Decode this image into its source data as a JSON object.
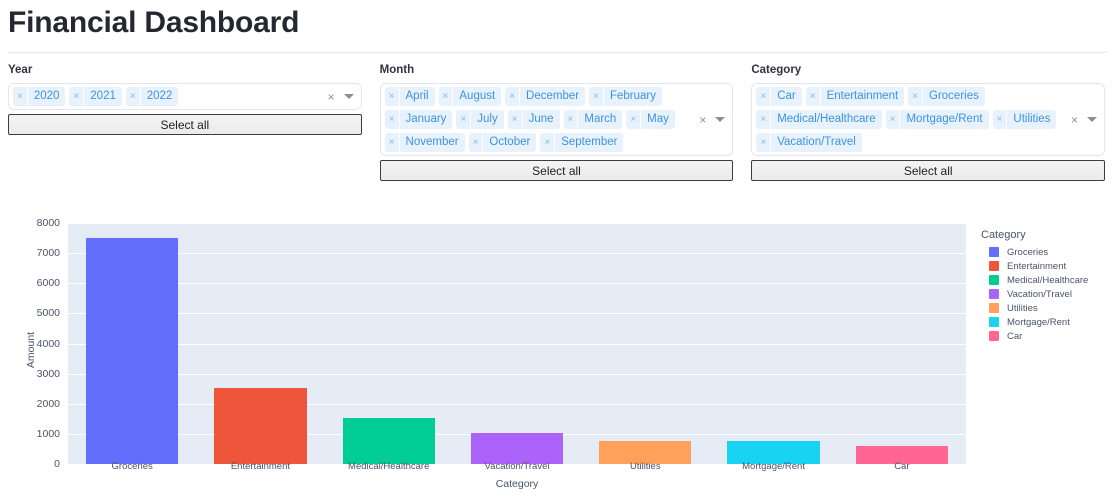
{
  "header": {
    "title": "Financial Dashboard"
  },
  "filters": [
    {
      "label": "Year",
      "tags": [
        "2020",
        "2021",
        "2022"
      ],
      "remove_icon": "×",
      "clear_icon": "×",
      "caret_icon": "chevron-down-icon",
      "select_all_label": "Select all"
    },
    {
      "label": "Month",
      "tags": [
        "April",
        "August",
        "December",
        "February",
        "January",
        "July",
        "June",
        "March",
        "May",
        "November",
        "October",
        "September"
      ],
      "remove_icon": "×",
      "clear_icon": "×",
      "caret_icon": "chevron-down-icon",
      "select_all_label": "Select all"
    },
    {
      "label": "Category",
      "tags": [
        "Car",
        "Entertainment",
        "Groceries",
        "Medical/Healthcare",
        "Mortgage/Rent",
        "Utilities",
        "Vacation/Travel"
      ],
      "remove_icon": "×",
      "clear_icon": "×",
      "caret_icon": "chevron-down-icon",
      "select_all_label": "Select all"
    }
  ],
  "chart_data": {
    "type": "bar",
    "title": "",
    "xlabel": "Category",
    "ylabel": "Amount",
    "categories": [
      "Groceries",
      "Entertainment",
      "Medical/Healthcare",
      "Vacation/Travel",
      "Utilities",
      "Mortgage/Rent",
      "Car"
    ],
    "values": [
      7500,
      2510,
      1520,
      1020,
      780,
      750,
      610
    ],
    "colors": [
      "#636efa",
      "#ef553b",
      "#00cc96",
      "#ab63fa",
      "#ffa15a",
      "#19d3f3",
      "#ff6692"
    ],
    "ylim": [
      0,
      8000
    ],
    "yticks": [
      0,
      1000,
      2000,
      3000,
      4000,
      5000,
      6000,
      7000,
      8000
    ],
    "ytick_labels": [
      "0",
      "1000",
      "2000",
      "3000",
      "4000",
      "5000",
      "6000",
      "7000",
      "8000"
    ],
    "grid": true,
    "legend": {
      "title": "Category",
      "position": "right",
      "entries": [
        {
          "label": "Groceries",
          "color": "#636efa"
        },
        {
          "label": "Entertainment",
          "color": "#ef553b"
        },
        {
          "label": "Medical/Healthcare",
          "color": "#00cc96"
        },
        {
          "label": "Vacation/Travel",
          "color": "#ab63fa"
        },
        {
          "label": "Utilities",
          "color": "#ffa15a"
        },
        {
          "label": "Mortgage/Rent",
          "color": "#19d3f3"
        },
        {
          "label": "Car",
          "color": "#ff6692"
        }
      ]
    },
    "plot_bgcolor": "#e5ecf6",
    "gridcolor": "#ffffff"
  }
}
